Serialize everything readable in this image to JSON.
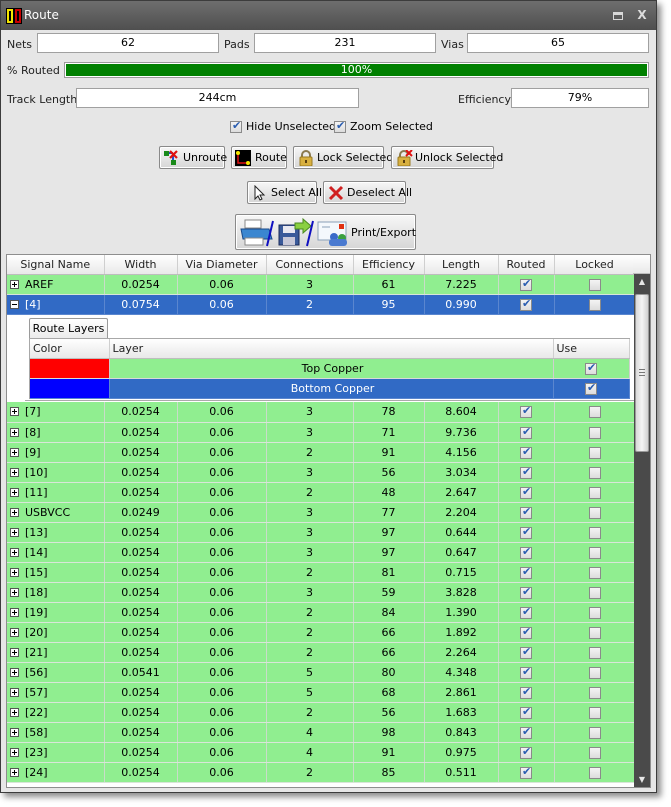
{
  "window": {
    "title": "Route",
    "restore_icon": "restore-icon",
    "close_label": "X"
  },
  "stats": {
    "nets_label": "Nets",
    "nets_value": "62",
    "pads_label": "Pads",
    "pads_value": "231",
    "vias_label": "Vias",
    "vias_value": "65",
    "routed_label": "% Routed",
    "routed_text": "100%",
    "routed_fraction": 1.0,
    "track_length_label": "Track Length",
    "track_length_value": "244cm",
    "efficiency_label": "Efficiency",
    "efficiency_value": "79%"
  },
  "options": {
    "hide_unselected": {
      "label": "Hide Unselected",
      "checked": true
    },
    "zoom_selected": {
      "label": "Zoom Selected",
      "checked": true
    }
  },
  "buttons": {
    "unroute": "Unroute",
    "route": "Route",
    "lock_selected": "Lock Selected",
    "unlock_selected": "Unlock Selected",
    "select_all": "Select All",
    "deselect_all": "Deselect All",
    "print_export": "Print/Export"
  },
  "grid": {
    "columns": [
      "Signal Name",
      "Width",
      "Via Diameter",
      "Connections",
      "Efficiency",
      "Length",
      "Routed",
      "Locked"
    ],
    "rows": [
      {
        "name": "AREF",
        "width": "0.0254",
        "via": "0.06",
        "connections": "3",
        "efficiency": "61",
        "length": "7.225",
        "routed": true,
        "locked": false,
        "expanded": false
      },
      {
        "name": "[4]",
        "width": "0.0754",
        "via": "0.06",
        "connections": "2",
        "efficiency": "95",
        "length": "0.990",
        "routed": true,
        "locked": false,
        "expanded": true,
        "selected": true
      },
      {
        "name": "[7]",
        "width": "0.0254",
        "via": "0.06",
        "connections": "3",
        "efficiency": "78",
        "length": "8.604",
        "routed": true,
        "locked": false
      },
      {
        "name": "[8]",
        "width": "0.0254",
        "via": "0.06",
        "connections": "3",
        "efficiency": "71",
        "length": "9.736",
        "routed": true,
        "locked": false
      },
      {
        "name": "[9]",
        "width": "0.0254",
        "via": "0.06",
        "connections": "2",
        "efficiency": "91",
        "length": "4.156",
        "routed": true,
        "locked": false
      },
      {
        "name": "[10]",
        "width": "0.0254",
        "via": "0.06",
        "connections": "3",
        "efficiency": "56",
        "length": "3.034",
        "routed": true,
        "locked": false
      },
      {
        "name": "[11]",
        "width": "0.0254",
        "via": "0.06",
        "connections": "2",
        "efficiency": "48",
        "length": "2.647",
        "routed": true,
        "locked": false
      },
      {
        "name": "USBVCC",
        "width": "0.0249",
        "via": "0.06",
        "connections": "3",
        "efficiency": "77",
        "length": "2.204",
        "routed": true,
        "locked": false
      },
      {
        "name": "[13]",
        "width": "0.0254",
        "via": "0.06",
        "connections": "3",
        "efficiency": "97",
        "length": "0.644",
        "routed": true,
        "locked": false
      },
      {
        "name": "[14]",
        "width": "0.0254",
        "via": "0.06",
        "connections": "3",
        "efficiency": "97",
        "length": "0.647",
        "routed": true,
        "locked": false
      },
      {
        "name": "[15]",
        "width": "0.0254",
        "via": "0.06",
        "connections": "2",
        "efficiency": "81",
        "length": "0.715",
        "routed": true,
        "locked": false
      },
      {
        "name": "[18]",
        "width": "0.0254",
        "via": "0.06",
        "connections": "3",
        "efficiency": "59",
        "length": "3.828",
        "routed": true,
        "locked": false
      },
      {
        "name": "[19]",
        "width": "0.0254",
        "via": "0.06",
        "connections": "2",
        "efficiency": "84",
        "length": "1.390",
        "routed": true,
        "locked": false
      },
      {
        "name": "[20]",
        "width": "0.0254",
        "via": "0.06",
        "connections": "2",
        "efficiency": "66",
        "length": "1.892",
        "routed": true,
        "locked": false
      },
      {
        "name": "[21]",
        "width": "0.0254",
        "via": "0.06",
        "connections": "2",
        "efficiency": "66",
        "length": "2.264",
        "routed": true,
        "locked": false
      },
      {
        "name": "[56]",
        "width": "0.0541",
        "via": "0.06",
        "connections": "5",
        "efficiency": "80",
        "length": "4.348",
        "routed": true,
        "locked": false
      },
      {
        "name": "[57]",
        "width": "0.0254",
        "via": "0.06",
        "connections": "5",
        "efficiency": "68",
        "length": "2.861",
        "routed": true,
        "locked": false
      },
      {
        "name": "[22]",
        "width": "0.0254",
        "via": "0.06",
        "connections": "2",
        "efficiency": "56",
        "length": "1.683",
        "routed": true,
        "locked": false
      },
      {
        "name": "[58]",
        "width": "0.0254",
        "via": "0.06",
        "connections": "4",
        "efficiency": "98",
        "length": "0.843",
        "routed": true,
        "locked": false
      },
      {
        "name": "[23]",
        "width": "0.0254",
        "via": "0.06",
        "connections": "4",
        "efficiency": "91",
        "length": "0.975",
        "routed": true,
        "locked": false
      },
      {
        "name": "[24]",
        "width": "0.0254",
        "via": "0.06",
        "connections": "2",
        "efficiency": "85",
        "length": "0.511",
        "routed": true,
        "locked": false
      }
    ]
  },
  "route_layers": {
    "tab_label": "Route Layers",
    "columns": [
      "Color",
      "Layer",
      "Use"
    ],
    "rows": [
      {
        "color": "#ff0000",
        "layer": "Top Copper",
        "use": true
      },
      {
        "color": "#0000ff",
        "layer": "Bottom Copper",
        "use": true,
        "selected": true
      }
    ]
  },
  "colors": {
    "row_bg": "#90ee90",
    "selected_bg": "#316ac5",
    "progress_fill": "#008000"
  }
}
